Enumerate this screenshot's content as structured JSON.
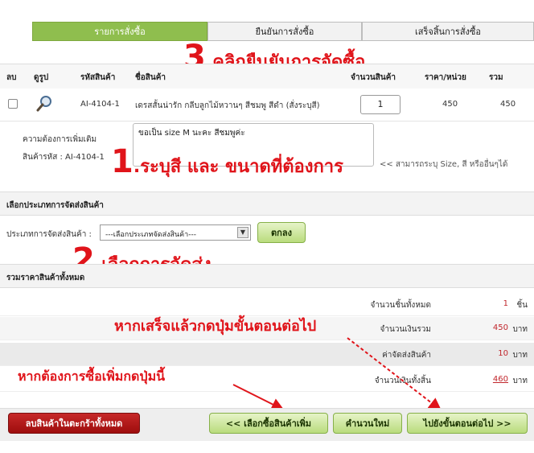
{
  "steps": [
    {
      "label": "รายการสั่งซื้อ"
    },
    {
      "label": "ยืนยันการสั่งซื้อ"
    },
    {
      "label": "เสร็จสิ้นการสั่งซื้อ"
    }
  ],
  "annotations": {
    "step3_num": "3",
    "step3_text": ".คลิกยืนยันการจัดซื้อ",
    "step1_num": "1",
    "step1_text": ".ระบุสี และ ขนาดที่ต้องการ",
    "step2_num": "2",
    "step2_text": ".เลือกการจัดส่ง",
    "next_hint": "หากเสร็จแล้วกดปุ่มขั้นตอนต่อไป",
    "more_hint": "หากต้องการซื้อเพิ่มกดปุ่มนี้"
  },
  "table": {
    "headers": {
      "delete": "ลบ",
      "view": "ดูรูป",
      "code": "รหัสสินค้า",
      "name": "ชื่อสินค้า",
      "qty": "จำนวนสินค้า",
      "price": "ราคา/หน่วย",
      "total": "รวม"
    },
    "row": {
      "code": "AI-4104-1",
      "name": "เดรสสั้นน่ารัก กลีบลูกไม้หวานๆ สีชมพู สีดำ (สั่งระบุสี)",
      "qty": "1",
      "price": "450",
      "total": "450"
    }
  },
  "notes": {
    "label": "ความต้องการเพิ่มเติม",
    "code_label": "สินค้ารหัส : AI-4104-1",
    "value": "ขอเป็น size M นะคะ สีชมพูค่ะ",
    "hint": "<< สามารถระบุ Size, สี หรืออื่นๆได้"
  },
  "shipping": {
    "section_title": "เลือกประเภทการจัดส่งสินค้า",
    "label": "ประเภทการจัดส่งสินค้า :",
    "select_value": "---เลือกประเภทจัดส่งสินค้า---",
    "ok_button": "ตกลง"
  },
  "summary": {
    "section_title": "รวมราคาสินค้าทั้งหมด",
    "rows": [
      {
        "label": "จำนวนชิ้นทั้งหมด",
        "value": "1",
        "unit": "ชิ้น"
      },
      {
        "label": "จำนวนเงินรวม",
        "value": "450",
        "unit": "บาท"
      },
      {
        "label": "ค่าจัดส่งสินค้า",
        "value": "10",
        "unit": "บาท"
      },
      {
        "label": "จำนวนเงินทั้งสิ้น",
        "value": "460",
        "unit": "บาท"
      }
    ]
  },
  "buttons": {
    "clear_cart": "ลบสินค้าในตะกร้าทั้งหมด",
    "continue_shopping": "<< เลือกซื้อสินค้าเพิ่ม",
    "recalculate": "คำนวนใหม่",
    "next_step": "ไปยังขั้นตอนต่อไป >>"
  },
  "colors": {
    "active_step": "#8fbe4e",
    "annotation_red": "#e0141a",
    "price_red": "#c1272d",
    "clear_button": "#b71c1c"
  }
}
